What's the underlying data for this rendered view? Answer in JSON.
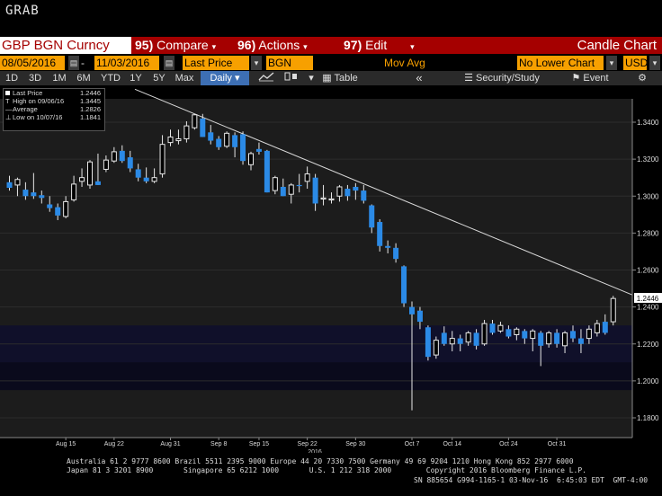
{
  "top": {
    "title": "GRAB"
  },
  "command_bar": {
    "ticker": "GBP BGN Curncy",
    "compare": {
      "num": "95)",
      "label": "Compare"
    },
    "actions": {
      "num": "96)",
      "label": "Actions"
    },
    "edit": {
      "num": "97)",
      "label": "Edit"
    },
    "chart_type": "Candle Chart"
  },
  "date_bar": {
    "start_date": "08/05/2016",
    "end_date": "11/03/2016",
    "price_field": "Last Price",
    "source": "BGN",
    "mov_avg": "Mov Avg",
    "lower_chart": "No Lower Chart",
    "currency": "USD"
  },
  "toolbar": {
    "periods": [
      "1D",
      "3D",
      "1M",
      "6M",
      "YTD",
      "1Y",
      "5Y",
      "Max"
    ],
    "frequency": "Daily",
    "table": "Table",
    "security_study": "Security/Study",
    "event": "Event"
  },
  "legend": {
    "last_price": {
      "label": "Last Price",
      "value": "1.2446"
    },
    "high": {
      "label": "High on 09/06/16",
      "value": "1.3445"
    },
    "average": {
      "label": "Average",
      "value": "1.2826"
    },
    "low": {
      "label": "Low on 10/07/16",
      "value": "1.1841"
    }
  },
  "chart_data": {
    "type": "candlestick",
    "ylim": [
      1.175,
      1.36
    ],
    "yticks": [
      "1.3400",
      "1.3200",
      "1.3000",
      "1.2800",
      "1.2600",
      "1.2400",
      "1.2200",
      "1.2000",
      "1.1800"
    ],
    "xtick_labels": [
      "Aug 15",
      "Aug 22",
      "Aug 31",
      "Sep 8",
      "Sep 15",
      "Sep 22",
      "Sep 30",
      "Oct 7",
      "Oct 14",
      "Oct 24",
      "Oct 31"
    ],
    "year_label": "2016",
    "last_price_label": "1.2446",
    "candles": [
      {
        "o": 1.3075,
        "h": 1.311,
        "l": 1.303,
        "c": 1.3045
      },
      {
        "o": 1.306,
        "h": 1.31,
        "l": 1.3,
        "c": 1.309
      },
      {
        "o": 1.3035,
        "h": 1.3075,
        "l": 1.298,
        "c": 1.3
      },
      {
        "o": 1.302,
        "h": 1.3125,
        "l": 1.2985,
        "c": 1.3
      },
      {
        "o": 1.3005,
        "h": 1.303,
        "l": 1.296,
        "c": 1.299
      },
      {
        "o": 1.2955,
        "h": 1.3,
        "l": 1.2915,
        "c": 1.2935
      },
      {
        "o": 1.294,
        "h": 1.296,
        "l": 1.287,
        "c": 1.2895
      },
      {
        "o": 1.289,
        "h": 1.3,
        "l": 1.288,
        "c": 1.297
      },
      {
        "o": 1.298,
        "h": 1.311,
        "l": 1.297,
        "c": 1.3065
      },
      {
        "o": 1.308,
        "h": 1.315,
        "l": 1.305,
        "c": 1.31
      },
      {
        "o": 1.306,
        "h": 1.3195,
        "l": 1.304,
        "c": 1.3185
      },
      {
        "o": 1.308,
        "h": 1.323,
        "l": 1.306,
        "c": 1.306
      },
      {
        "o": 1.3145,
        "h": 1.322,
        "l": 1.313,
        "c": 1.3195
      },
      {
        "o": 1.319,
        "h": 1.3265,
        "l": 1.318,
        "c": 1.324
      },
      {
        "o": 1.3245,
        "h": 1.3275,
        "l": 1.318,
        "c": 1.319
      },
      {
        "o": 1.321,
        "h": 1.3245,
        "l": 1.313,
        "c": 1.315
      },
      {
        "o": 1.3145,
        "h": 1.3175,
        "l": 1.308,
        "c": 1.31
      },
      {
        "o": 1.31,
        "h": 1.3155,
        "l": 1.307,
        "c": 1.308
      },
      {
        "o": 1.308,
        "h": 1.315,
        "l": 1.307,
        "c": 1.31
      },
      {
        "o": 1.312,
        "h": 1.333,
        "l": 1.31,
        "c": 1.328
      },
      {
        "o": 1.329,
        "h": 1.336,
        "l": 1.327,
        "c": 1.332
      },
      {
        "o": 1.33,
        "h": 1.336,
        "l": 1.328,
        "c": 1.331
      },
      {
        "o": 1.331,
        "h": 1.3405,
        "l": 1.329,
        "c": 1.338
      },
      {
        "o": 1.337,
        "h": 1.3445,
        "l": 1.336,
        "c": 1.344
      },
      {
        "o": 1.342,
        "h": 1.3445,
        "l": 1.332,
        "c": 1.332
      },
      {
        "o": 1.3345,
        "h": 1.3385,
        "l": 1.328,
        "c": 1.33
      },
      {
        "o": 1.331,
        "h": 1.3325,
        "l": 1.325,
        "c": 1.3265
      },
      {
        "o": 1.327,
        "h": 1.335,
        "l": 1.326,
        "c": 1.334
      },
      {
        "o": 1.333,
        "h": 1.3345,
        "l": 1.321,
        "c": 1.3265
      },
      {
        "o": 1.3335,
        "h": 1.335,
        "l": 1.317,
        "c": 1.319
      },
      {
        "o": 1.317,
        "h": 1.324,
        "l": 1.314,
        "c": 1.323
      },
      {
        "o": 1.3255,
        "h": 1.329,
        "l": 1.3225,
        "c": 1.324
      },
      {
        "o": 1.3245,
        "h": 1.325,
        "l": 1.302,
        "c": 1.302
      },
      {
        "o": 1.303,
        "h": 1.311,
        "l": 1.301,
        "c": 1.31
      },
      {
        "o": 1.305,
        "h": 1.3095,
        "l": 1.3,
        "c": 1.3
      },
      {
        "o": 1.301,
        "h": 1.307,
        "l": 1.296,
        "c": 1.306
      },
      {
        "o": 1.306,
        "h": 1.312,
        "l": 1.302,
        "c": 1.3055
      },
      {
        "o": 1.308,
        "h": 1.316,
        "l": 1.304,
        "c": 1.312
      },
      {
        "o": 1.31,
        "h": 1.312,
        "l": 1.292,
        "c": 1.296
      },
      {
        "o": 1.299,
        "h": 1.306,
        "l": 1.295,
        "c": 1.299
      },
      {
        "o": 1.298,
        "h": 1.302,
        "l": 1.296,
        "c": 1.2985
      },
      {
        "o": 1.3,
        "h": 1.306,
        "l": 1.297,
        "c": 1.305
      },
      {
        "o": 1.304,
        "h": 1.306,
        "l": 1.2975,
        "c": 1.3
      },
      {
        "o": 1.305,
        "h": 1.307,
        "l": 1.298,
        "c": 1.303
      },
      {
        "o": 1.303,
        "h": 1.306,
        "l": 1.296,
        "c": 1.2975
      },
      {
        "o": 1.295,
        "h": 1.2955,
        "l": 1.28,
        "c": 1.283
      },
      {
        "o": 1.286,
        "h": 1.2875,
        "l": 1.27,
        "c": 1.273
      },
      {
        "o": 1.273,
        "h": 1.276,
        "l": 1.269,
        "c": 1.272
      },
      {
        "o": 1.272,
        "h": 1.2745,
        "l": 1.264,
        "c": 1.266
      },
      {
        "o": 1.262,
        "h": 1.2625,
        "l": 1.24,
        "c": 1.242
      },
      {
        "o": 1.24,
        "h": 1.243,
        "l": 1.1841,
        "c": 1.236
      },
      {
        "o": 1.238,
        "h": 1.24,
        "l": 1.228,
        "c": 1.232
      },
      {
        "o": 1.229,
        "h": 1.23,
        "l": 1.211,
        "c": 1.213
      },
      {
        "o": 1.214,
        "h": 1.224,
        "l": 1.212,
        "c": 1.222
      },
      {
        "o": 1.226,
        "h": 1.2295,
        "l": 1.219,
        "c": 1.22
      },
      {
        "o": 1.22,
        "h": 1.227,
        "l": 1.216,
        "c": 1.223
      },
      {
        "o": 1.223,
        "h": 1.225,
        "l": 1.216,
        "c": 1.22
      },
      {
        "o": 1.221,
        "h": 1.227,
        "l": 1.219,
        "c": 1.226
      },
      {
        "o": 1.226,
        "h": 1.228,
        "l": 1.217,
        "c": 1.219
      },
      {
        "o": 1.22,
        "h": 1.233,
        "l": 1.219,
        "c": 1.231
      },
      {
        "o": 1.231,
        "h": 1.233,
        "l": 1.225,
        "c": 1.226
      },
      {
        "o": 1.227,
        "h": 1.232,
        "l": 1.226,
        "c": 1.23
      },
      {
        "o": 1.228,
        "h": 1.23,
        "l": 1.223,
        "c": 1.224
      },
      {
        "o": 1.225,
        "h": 1.229,
        "l": 1.222,
        "c": 1.228
      },
      {
        "o": 1.227,
        "h": 1.228,
        "l": 1.22,
        "c": 1.223
      },
      {
        "o": 1.223,
        "h": 1.228,
        "l": 1.216,
        "c": 1.227
      },
      {
        "o": 1.226,
        "h": 1.227,
        "l": 1.208,
        "c": 1.219
      },
      {
        "o": 1.22,
        "h": 1.227,
        "l": 1.218,
        "c": 1.226
      },
      {
        "o": 1.226,
        "h": 1.228,
        "l": 1.218,
        "c": 1.22
      },
      {
        "o": 1.219,
        "h": 1.227,
        "l": 1.215,
        "c": 1.226
      },
      {
        "o": 1.227,
        "h": 1.23,
        "l": 1.221,
        "c": 1.223
      },
      {
        "o": 1.223,
        "h": 1.228,
        "l": 1.215,
        "c": 1.22
      },
      {
        "o": 1.223,
        "h": 1.23,
        "l": 1.22,
        "c": 1.228
      },
      {
        "o": 1.226,
        "h": 1.233,
        "l": 1.224,
        "c": 1.231
      },
      {
        "o": 1.232,
        "h": 1.236,
        "l": 1.225,
        "c": 1.226
      },
      {
        "o": 1.232,
        "h": 1.246,
        "l": 1.23,
        "c": 1.2446
      }
    ],
    "trendline": {
      "from": {
        "index": 23,
        "price": 1.3445
      },
      "to": {
        "index": 76,
        "price": 1.249
      }
    }
  },
  "footer": {
    "line1": "Australia 61 2 9777 8600 Brazil 5511 2395 9000 Europe 44 20 7330 7500 Germany 49 69 9204 1210 Hong Kong 852 2977 6000",
    "line2": "Japan 81 3 3201 8900       Singapore 65 6212 1000       U.S. 1 212 318 2000        Copyright 2016 Bloomberg Finance L.P.",
    "line3": "SN 885654 G994-1165-1 03-Nov-16  6:45:03 EDT  GMT-4:00"
  }
}
